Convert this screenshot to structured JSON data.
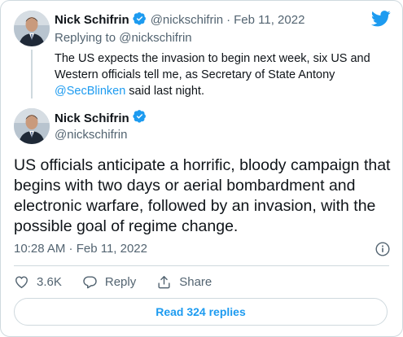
{
  "parent_tweet": {
    "author_name": "Nick Schifrin",
    "handle": "@nickschifrin",
    "separator": "·",
    "date": "Feb 11, 2022",
    "replying_to_prefix": "Replying to ",
    "replying_to_handle": "@nickschifrin",
    "text_before_link": "The US expects the invasion to begin next week, six US and Western officials tell me, as Secretary of State Antony ",
    "link_text": "@SecBlinken",
    "text_after_link": " said last night."
  },
  "main_tweet": {
    "author_name": "Nick Schifrin",
    "handle": "@nickschifrin",
    "text": "US officials anticipate a horrific, bloody campaign that begins with two days or aerial bombardment and electronic warfare, followed by an invasion, with the possible goal of regime change.",
    "timestamp": "10:28 AM · Feb 11, 2022"
  },
  "actions": {
    "like_count": "3.6K",
    "reply_label": "Reply",
    "share_label": "Share"
  },
  "read_replies_label": "Read 324 replies",
  "colors": {
    "accent": "#1d9bf0",
    "text": "#0f1419",
    "muted": "#536471",
    "border": "#cfd9de"
  },
  "icons": [
    "twitter-logo-icon",
    "verified-badge-icon",
    "info-icon",
    "heart-icon",
    "reply-icon",
    "share-icon"
  ]
}
